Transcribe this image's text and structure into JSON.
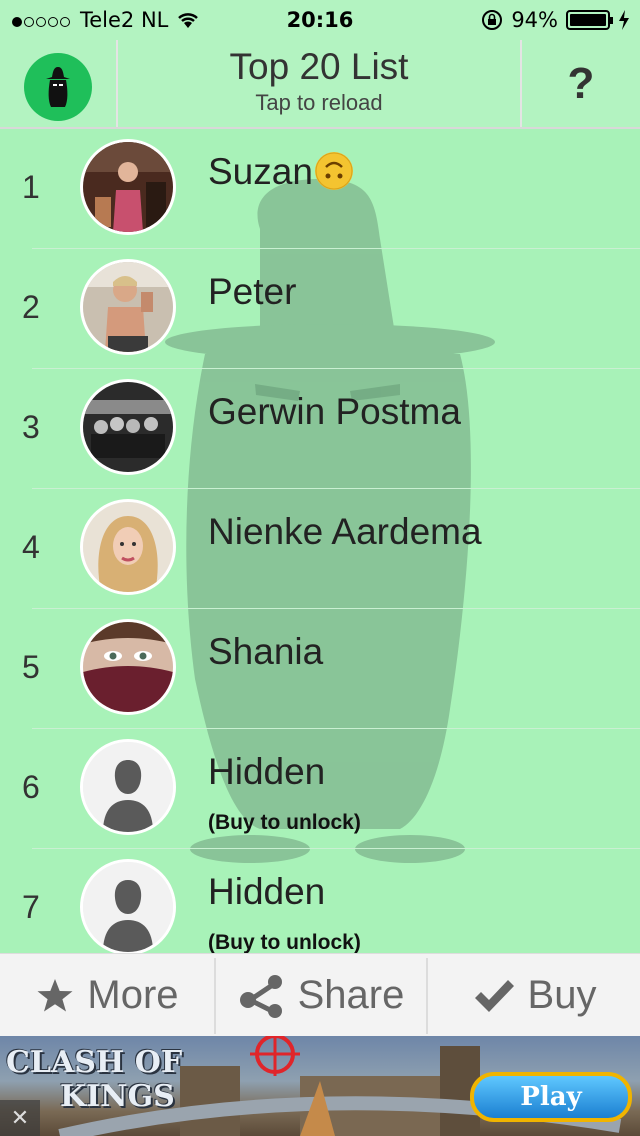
{
  "status_bar": {
    "carrier": "Tele2 NL",
    "time": "20:16",
    "battery": "94%",
    "battery_level": 0.94,
    "signal_bars": 1,
    "signal_total": 5
  },
  "header": {
    "title": "Top 20 List",
    "subtitle": "Tap to reload",
    "help_label": "?"
  },
  "list": {
    "rows": [
      {
        "rank": "1",
        "name": "Suzan",
        "sub": "",
        "emoji": "upside-down-face",
        "avatar": "photo"
      },
      {
        "rank": "2",
        "name": "Peter",
        "sub": "",
        "avatar": "photo"
      },
      {
        "rank": "3",
        "name": "Gerwin Postma",
        "sub": "",
        "avatar": "photo"
      },
      {
        "rank": "4",
        "name": "Nienke Aardema",
        "sub": "",
        "avatar": "photo"
      },
      {
        "rank": "5",
        "name": "Shania",
        "sub": "",
        "avatar": "photo"
      },
      {
        "rank": "6",
        "name": "Hidden",
        "sub": "(Buy to unlock)",
        "avatar": "placeholder"
      },
      {
        "rank": "7",
        "name": "Hidden",
        "sub": "(Buy to unlock)",
        "avatar": "placeholder"
      }
    ]
  },
  "toolbar": {
    "more_label": "More",
    "share_label": "Share",
    "buy_label": "Buy"
  },
  "ad": {
    "logo_line1": "CLASH OF",
    "logo_line2": "KINGS",
    "play_label": "Play",
    "close_label": "✕"
  },
  "colors": {
    "background": "#a8f2b8",
    "logo_green": "#1fbf5a",
    "toolbar_bg": "#f3f3f3"
  }
}
